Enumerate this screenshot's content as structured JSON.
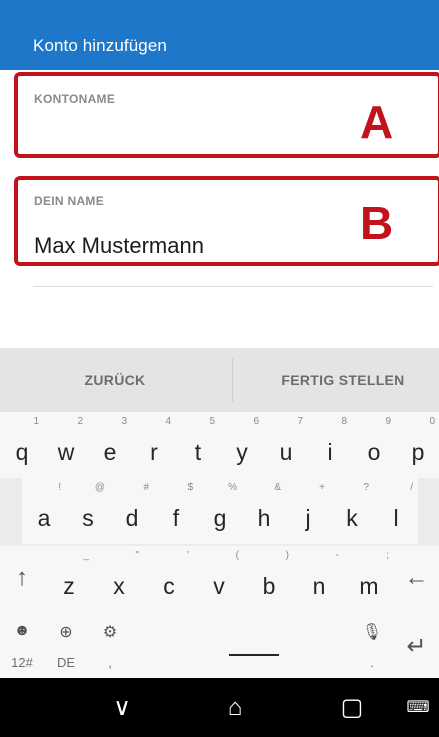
{
  "header": {
    "title": "Konto hinzufügen"
  },
  "form": {
    "account_name_label": "KONTONAME",
    "account_name_value": "",
    "marker_a": "A",
    "your_name_label": "DEIN NAME",
    "your_name_value": "Max Mustermann",
    "marker_b": "B"
  },
  "keyboard": {
    "action_back": "ZURÜCK",
    "action_done": "FERTIG STELLEN",
    "row1": [
      {
        "key": "q",
        "sub": "1"
      },
      {
        "key": "w",
        "sub": "2"
      },
      {
        "key": "e",
        "sub": "3"
      },
      {
        "key": "r",
        "sub": "4"
      },
      {
        "key": "t",
        "sub": "5"
      },
      {
        "key": "y",
        "sub": "6"
      },
      {
        "key": "u",
        "sub": "7"
      },
      {
        "key": "i",
        "sub": "8"
      },
      {
        "key": "o",
        "sub": "9"
      },
      {
        "key": "p",
        "sub": "0"
      }
    ],
    "row2": [
      {
        "key": "a",
        "sub": "!"
      },
      {
        "key": "s",
        "sub": "@"
      },
      {
        "key": "d",
        "sub": "#"
      },
      {
        "key": "f",
        "sub": "$"
      },
      {
        "key": "g",
        "sub": "%"
      },
      {
        "key": "h",
        "sub": "&"
      },
      {
        "key": "j",
        "sub": "+"
      },
      {
        "key": "k",
        "sub": "?"
      },
      {
        "key": "l",
        "sub": "/"
      }
    ],
    "row3": [
      {
        "key": "z",
        "sub": "_"
      },
      {
        "key": "x",
        "sub": "\""
      },
      {
        "key": "c",
        "sub": "'"
      },
      {
        "key": "v",
        "sub": "("
      },
      {
        "key": "b",
        "sub": ")"
      },
      {
        "key": "n",
        "sub": "-"
      },
      {
        "key": "m",
        "sub": ";"
      }
    ],
    "mode_label": "12#",
    "lang_label": "DE",
    "comma_label": ",",
    "period_label": "."
  },
  "colors": {
    "appbar": "#1f77c9",
    "annotation": "#c2121c"
  }
}
